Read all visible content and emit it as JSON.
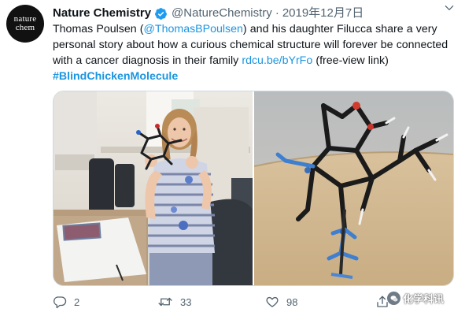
{
  "account": {
    "avatar_line1": "nature",
    "avatar_line2": "chem",
    "display_name": "Nature Chemistry",
    "handle": "@NatureChemistry",
    "separator": "·",
    "date": "2019年12月7日"
  },
  "tweet": {
    "text_1": "Thomas Poulsen (",
    "mention": "@ThomasBPoulsen",
    "text_2": ") and his daughter Filucca share a very personal story about how a curious chemical structure will forever be connected with a cancer diagnosis in their family ",
    "link": "rdcu.be/bYrFo",
    "text_3": " (free-view link) ",
    "hashtag": "#BlindChickenMolecule"
  },
  "actions": {
    "replies": "2",
    "retweets": "33",
    "likes": "98"
  },
  "watermark": "化学科讯",
  "colors": {
    "link": "#1b95e0",
    "verified": "#1d9bf0",
    "muted": "#536471",
    "text": "#0f1419"
  },
  "icons": [
    "verified-badge-icon",
    "caret-down-icon",
    "reply-icon",
    "retweet-icon",
    "like-icon",
    "share-icon",
    "wechat-icon"
  ]
}
